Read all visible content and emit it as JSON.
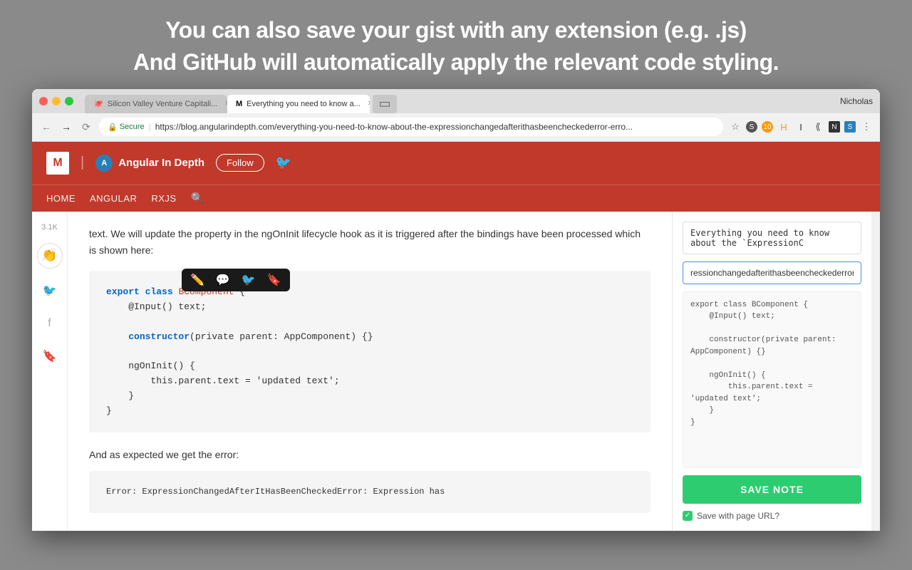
{
  "annotation": {
    "line1": "You can also save your gist with any extension (e.g. .js)",
    "line2": "And GitHub will automatically apply the relevant code styling."
  },
  "browser": {
    "tabs": [
      {
        "label": "Silicon Valley Venture Capitali...",
        "active": false,
        "icon": "github-icon"
      },
      {
        "label": "Everything you need to know a...",
        "active": true,
        "icon": "medium-icon"
      }
    ],
    "user": "Nicholas",
    "address": {
      "secure_label": "Secure",
      "url": "https://blog.angularindepth.com/everything-you-need-to-know-about-the-expressionchangedafterithasbeencheckederror-erro..."
    }
  },
  "site": {
    "publication": "Angular In Depth",
    "follow_label": "Follow",
    "nav_links": [
      "HOME",
      "ANGULAR",
      "RXJS"
    ]
  },
  "article": {
    "clap_count": "3.1K",
    "intro_text": "text. We will update the property in the ngOnInit lifecycle hook as it is triggered after the bindings have been processed which is shown here:",
    "code": {
      "line1": "export class BComponent {",
      "line2": "    @Input() text;",
      "line3": "",
      "line4": "    constructor(private parent: AppComponent) {}",
      "line5": "",
      "line6": "    ngOnInit() {",
      "line7": "        this.parent.text = 'updated text';",
      "line8": "    }",
      "line9": "}"
    },
    "bottom_text": "And as expected we get the error:"
  },
  "note_panel": {
    "title_value": "Everything you need to know about the `ExpressionC",
    "url_value": "ressionchangedafterithasbeencheckederror-erro.js",
    "code_lines": [
      "export class BComponent {",
      "    @Input() text;",
      "",
      "    constructor(private parent: AppComponent) {}",
      "",
      "    ngOnInit() {",
      "        this.parent.text = 'updated text';",
      "    }",
      "}"
    ],
    "save_button_label": "SAVE NOTE",
    "save_url_label": "Save with page URL?"
  },
  "toolbar": {
    "icons": [
      "pencil",
      "comment",
      "twitter",
      "bookmark"
    ]
  }
}
